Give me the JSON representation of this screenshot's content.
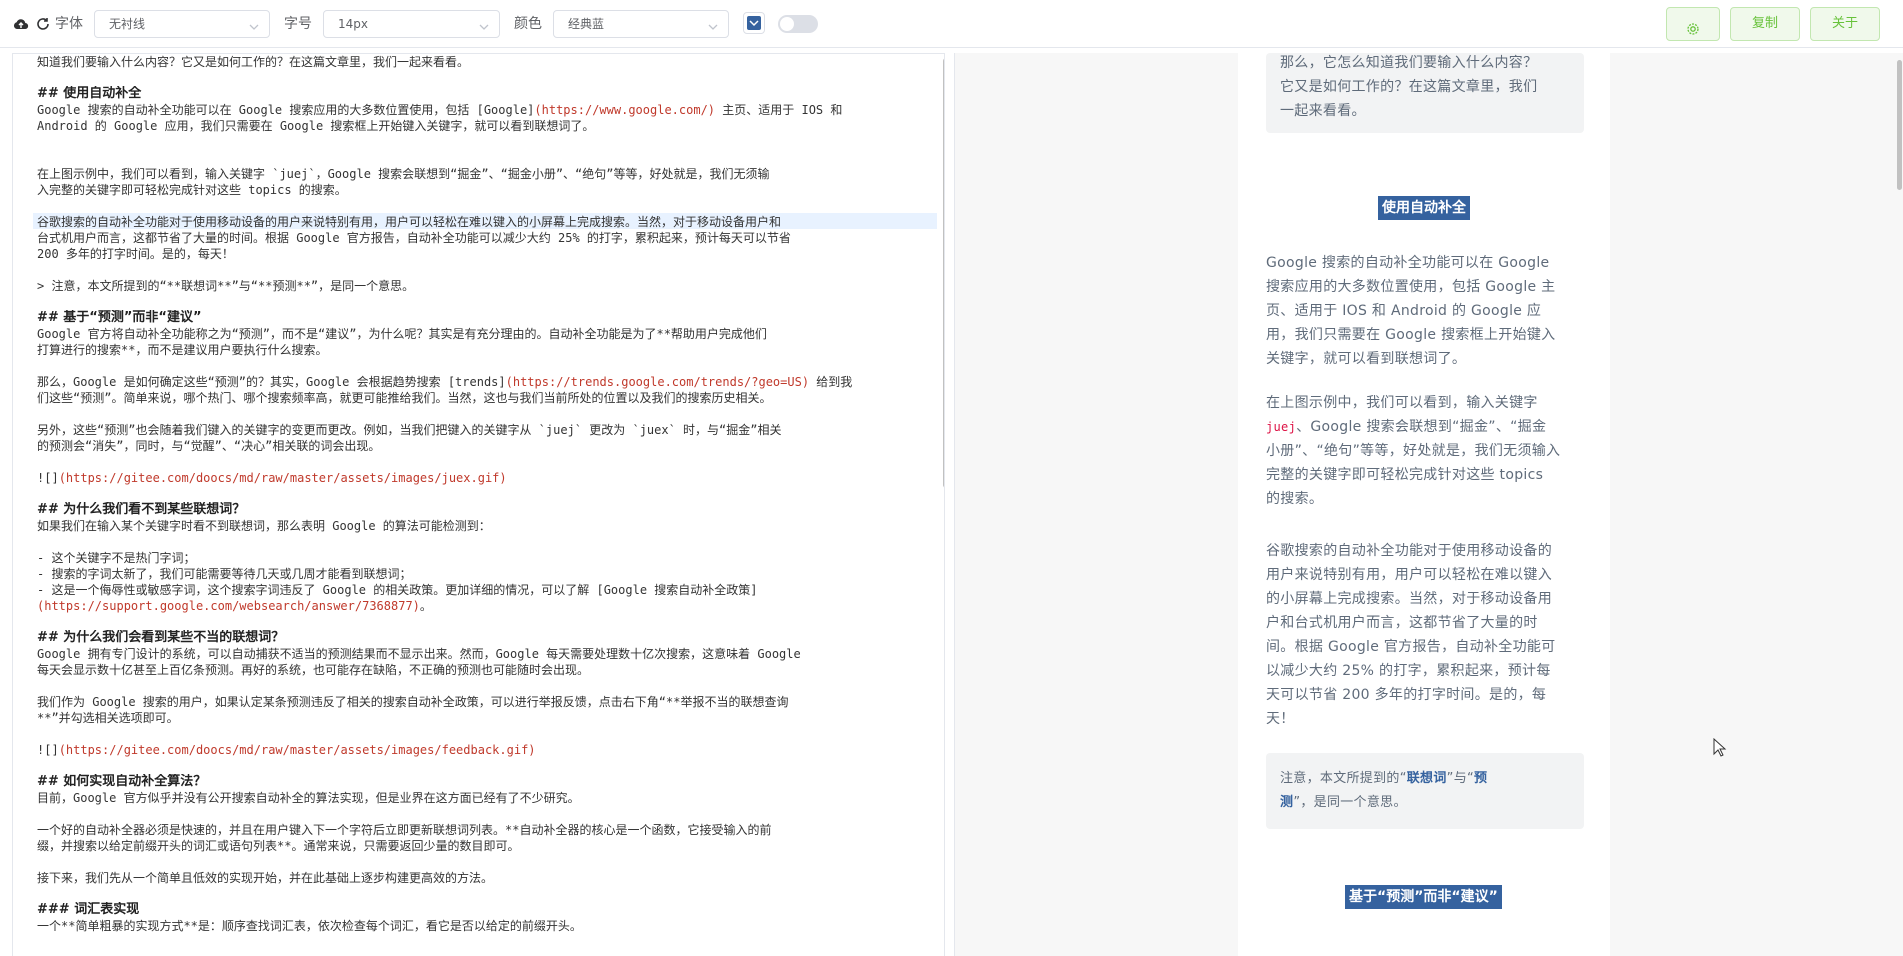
{
  "toolbar": {
    "font_label": "字体",
    "font_value": "无衬线",
    "size_label": "字号",
    "size_value": "14px",
    "color_label": "颜色",
    "color_value": "经典蓝",
    "accent_color": "#35629f",
    "copy_button": "复制",
    "about_button": "关于",
    "icons": [
      "cloud-upload-icon",
      "refresh-icon",
      "settings-icon"
    ]
  },
  "editor": {
    "lines": [
      "知道我们要输入什么内容？它又是如何工作的？在这篇文章里，我们一起来看看。",
      "",
      "## 使用自动补全",
      "Google 搜索的自动补全功能可以在 Google 搜索应用的大多数位置使用，包括 [Google](https://www.google.com/) 主页、适用于 IOS 和",
      "Android 的 Google 应用，我们只需要在 Google 搜索框上开始键入关键字，就可以看到联想词了。",
      "",
      "",
      "在上图示例中，我们可以看到，输入关键字 `juej`，Google 搜索会联想到“掘金”、“掘金小册”、“绝句”等等，好处就是，我们无须输",
      "入完整的关键字即可轻松完成针对这些 topics 的搜索。",
      "",
      "谷歌搜索的自动补全功能对于使用移动设备的用户来说特别有用，用户可以轻松在难以键入的小屏幕上完成搜索。当然，对于移动设备用户和",
      "台式机用户而言，这都节省了大量的时间。根据 Google 官方报告，自动补全功能可以减少大约 25% 的打字，累积起来，预计每天可以节省",
      "200 多年的打字时间。是的，每天！",
      "",
      "> 注意，本文所提到的“**联想词**”与“**预测**”，是同一个意思。",
      "",
      "## 基于“预测”而非“建议”",
      "Google 官方将自动补全功能称之为“预测”，而不是“建议”，为什么呢？其实是有充分理由的。自动补全功能是为了**帮助用户完成他们",
      "打算进行的搜索**，而不是建议用户要执行什么搜索。",
      "",
      "那么，Google 是如何确定这些“预测”的？其实，Google 会根据趋势搜索 [trends](https://trends.google.com/trends/?geo=US) 给到我",
      "们这些“预测”。简单来说，哪个热门、哪个搜索频率高，就更可能推给我们。当然，这也与我们当前所处的位置以及我们的搜索历史相关。",
      "",
      "另外，这些“预测”也会随着我们键入的关键字的变更而更改。例如，当我们把键入的关键字从 `juej` 更改为 `juex` 时，与“掘金”相关",
      "的预测会“消失”，同时，与“觉醒”、“决心”相关联的词会出现。",
      "",
      "![](https://gitee.com/doocs/md/raw/master/assets/images/juex.gif)",
      "",
      "## 为什么我们看不到某些联想词？",
      "如果我们在输入某个关键字时看不到联想词，那么表明 Google 的算法可能检测到：",
      "",
      "- 这个关键字不是热门字词；",
      "- 搜索的字词太新了，我们可能需要等待几天或几周才能看到联想词；",
      "- 这是一个侮辱性或敏感字词，这个搜索字词违反了 Google 的相关政策。更加详细的情况，可以了解 [Google 搜索自动补全政策]",
      "(https://support.google.com/websearch/answer/7368877)。",
      "",
      "## 为什么我们会看到某些不当的联想词？",
      "Google 拥有专门设计的系统，可以自动捕获不适当的预测结果而不显示出来。然而，Google 每天需要处理数十亿次搜索，这意味着 Google",
      "每天会显示数十亿甚至上百亿条预测。再好的系统，也可能存在缺陷，不正确的预测也可能随时会出现。",
      "",
      "我们作为 Google 搜索的用户，如果认定某条预测违反了相关的搜索自动补全政策，可以进行举报反馈，点击右下角“**举报不当的联想查询",
      "**”并勾选相关选项即可。",
      "",
      "![](https://gitee.com/doocs/md/raw/master/assets/images/feedback.gif)",
      "",
      "## 如何实现自动补全算法？",
      "目前，Google 官方似乎并没有公开搜索自动补全的算法实现，但是业界在这方面已经有了不少研究。",
      "",
      "一个好的自动补全器必须是快速的，并且在用户键入下一个字符后立即更新联想词列表。**自动补全器的核心是一个函数，它接受输入的前",
      "缀，并搜索以给定前缀开头的词汇或语句列表**。通常来说，只需要返回少量的数目即可。",
      "",
      "接下来，我们先从一个简单且低效的实现开始，并在此基础上逐步构建更高效的方法。",
      "",
      "### 词汇表实现",
      "一个**简单粗暴的实现方式**是：顺序查找词汇表，依次检查每个词汇，看它是否以给定的前缀开头。"
    ]
  },
  "preview": {
    "intro_quote": [
      "那么，它怎么知道我们要输入什么内容？",
      "它又是如何工作的？在这篇文章里，我们",
      "一起来看看。"
    ],
    "heading_1": "使用自动补全",
    "para_1": [
      "Google 搜索的自动补全功能可以在 Google",
      "搜索应用的大多数位置使用，包括 Google 主",
      "页、适用于 IOS 和 Android 的 Google 应",
      "用，我们只需要在 Google 搜索框上开始键入",
      "关键字，就可以看到联想词了。"
    ],
    "para_2_line1": "在上图示例中，我们可以看到，输入关键字",
    "para_2_code": "juej",
    "para_2_line2_rest": "、Google 搜索会联想到“掘金”、“掘金",
    "para_2_rest": [
      "小册”、“绝句”等等，好处就是，我们无须输入",
      "完整的关键字即可轻松完成针对这些 topics",
      "的搜索。"
    ],
    "para_3": [
      "谷歌搜索的自动补全功能对于使用移动设备的",
      "用户来说特别有用，用户可以轻松在难以键入",
      "的小屏幕上完成搜索。当然，对于移动设备用",
      "户和台式机用户而言，这都节省了大量的时",
      "间。根据 Google 官方报告，自动补全功能可",
      "以减少大约 25% 的打字，累积起来，预计每",
      "天可以节省 200 多年的打字时间。是的，每",
      "天！"
    ],
    "note_prefix": "注意，本文所提到的“",
    "note_strong1": "联想词",
    "note_mid": "”与“",
    "note_strong2": "预",
    "note_line2_strong": "测",
    "note_suffix": "”，是同一个意思。",
    "heading_2": "基于“预测”而非“建议”"
  }
}
